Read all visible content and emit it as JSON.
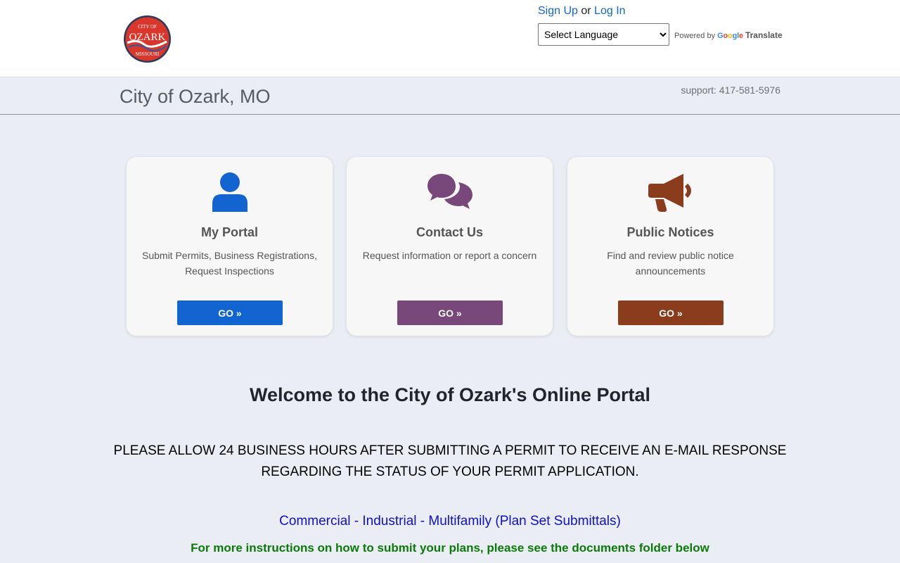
{
  "header": {
    "logo": {
      "icon": "city-seal-logo",
      "top_text": "CITY OF",
      "main_text": "OZARK",
      "bottom_text": "MISSOURI"
    },
    "auth": {
      "signup_label": "Sign Up",
      "or_text": "or",
      "login_label": "Log In"
    },
    "language": {
      "selected": "Select Language",
      "powered_by": "Powered by",
      "google_text": "Google",
      "translate_text": "Translate"
    }
  },
  "subheader": {
    "org_name": "City of Ozark, MO",
    "support": "support: 417-581-5976"
  },
  "cards": [
    {
      "icon": "user-icon",
      "title": "My Portal",
      "desc": "Submit Permits, Business Registrations, Request Inspections",
      "button": "GO »",
      "color": "#1264d1"
    },
    {
      "icon": "comments-icon",
      "title": "Contact Us",
      "desc": "Request information or report a concern",
      "button": "GO »",
      "color": "#774879"
    },
    {
      "icon": "megaphone-icon",
      "title": "Public Notices",
      "desc": "Find and review public notice announcements",
      "button": "GO »",
      "color": "#8a3c1c"
    }
  ],
  "main": {
    "welcome": "Welcome to the City of Ozark's Online Portal",
    "notice": "PLEASE ALLOW 24 BUSINESS HOURS AFTER SUBMITTING A PERMIT TO RECEIVE AN E-MAIL RESPONSE REGARDING THE STATUS OF YOUR PERMIT APPLICATION.",
    "commercial": "Commercial - Industrial - Multifamily (Plan Set Submittals)",
    "instructions": "For more instructions on how to submit your plans, please see the documents folder below"
  },
  "colors": {
    "link": "#1266d3",
    "portal_blue": "#1264d1",
    "contact_purple": "#774879",
    "notices_brown": "#8a3c1c",
    "commercial_blue": "#1010cc",
    "instructions_green": "#0a7a0a"
  }
}
